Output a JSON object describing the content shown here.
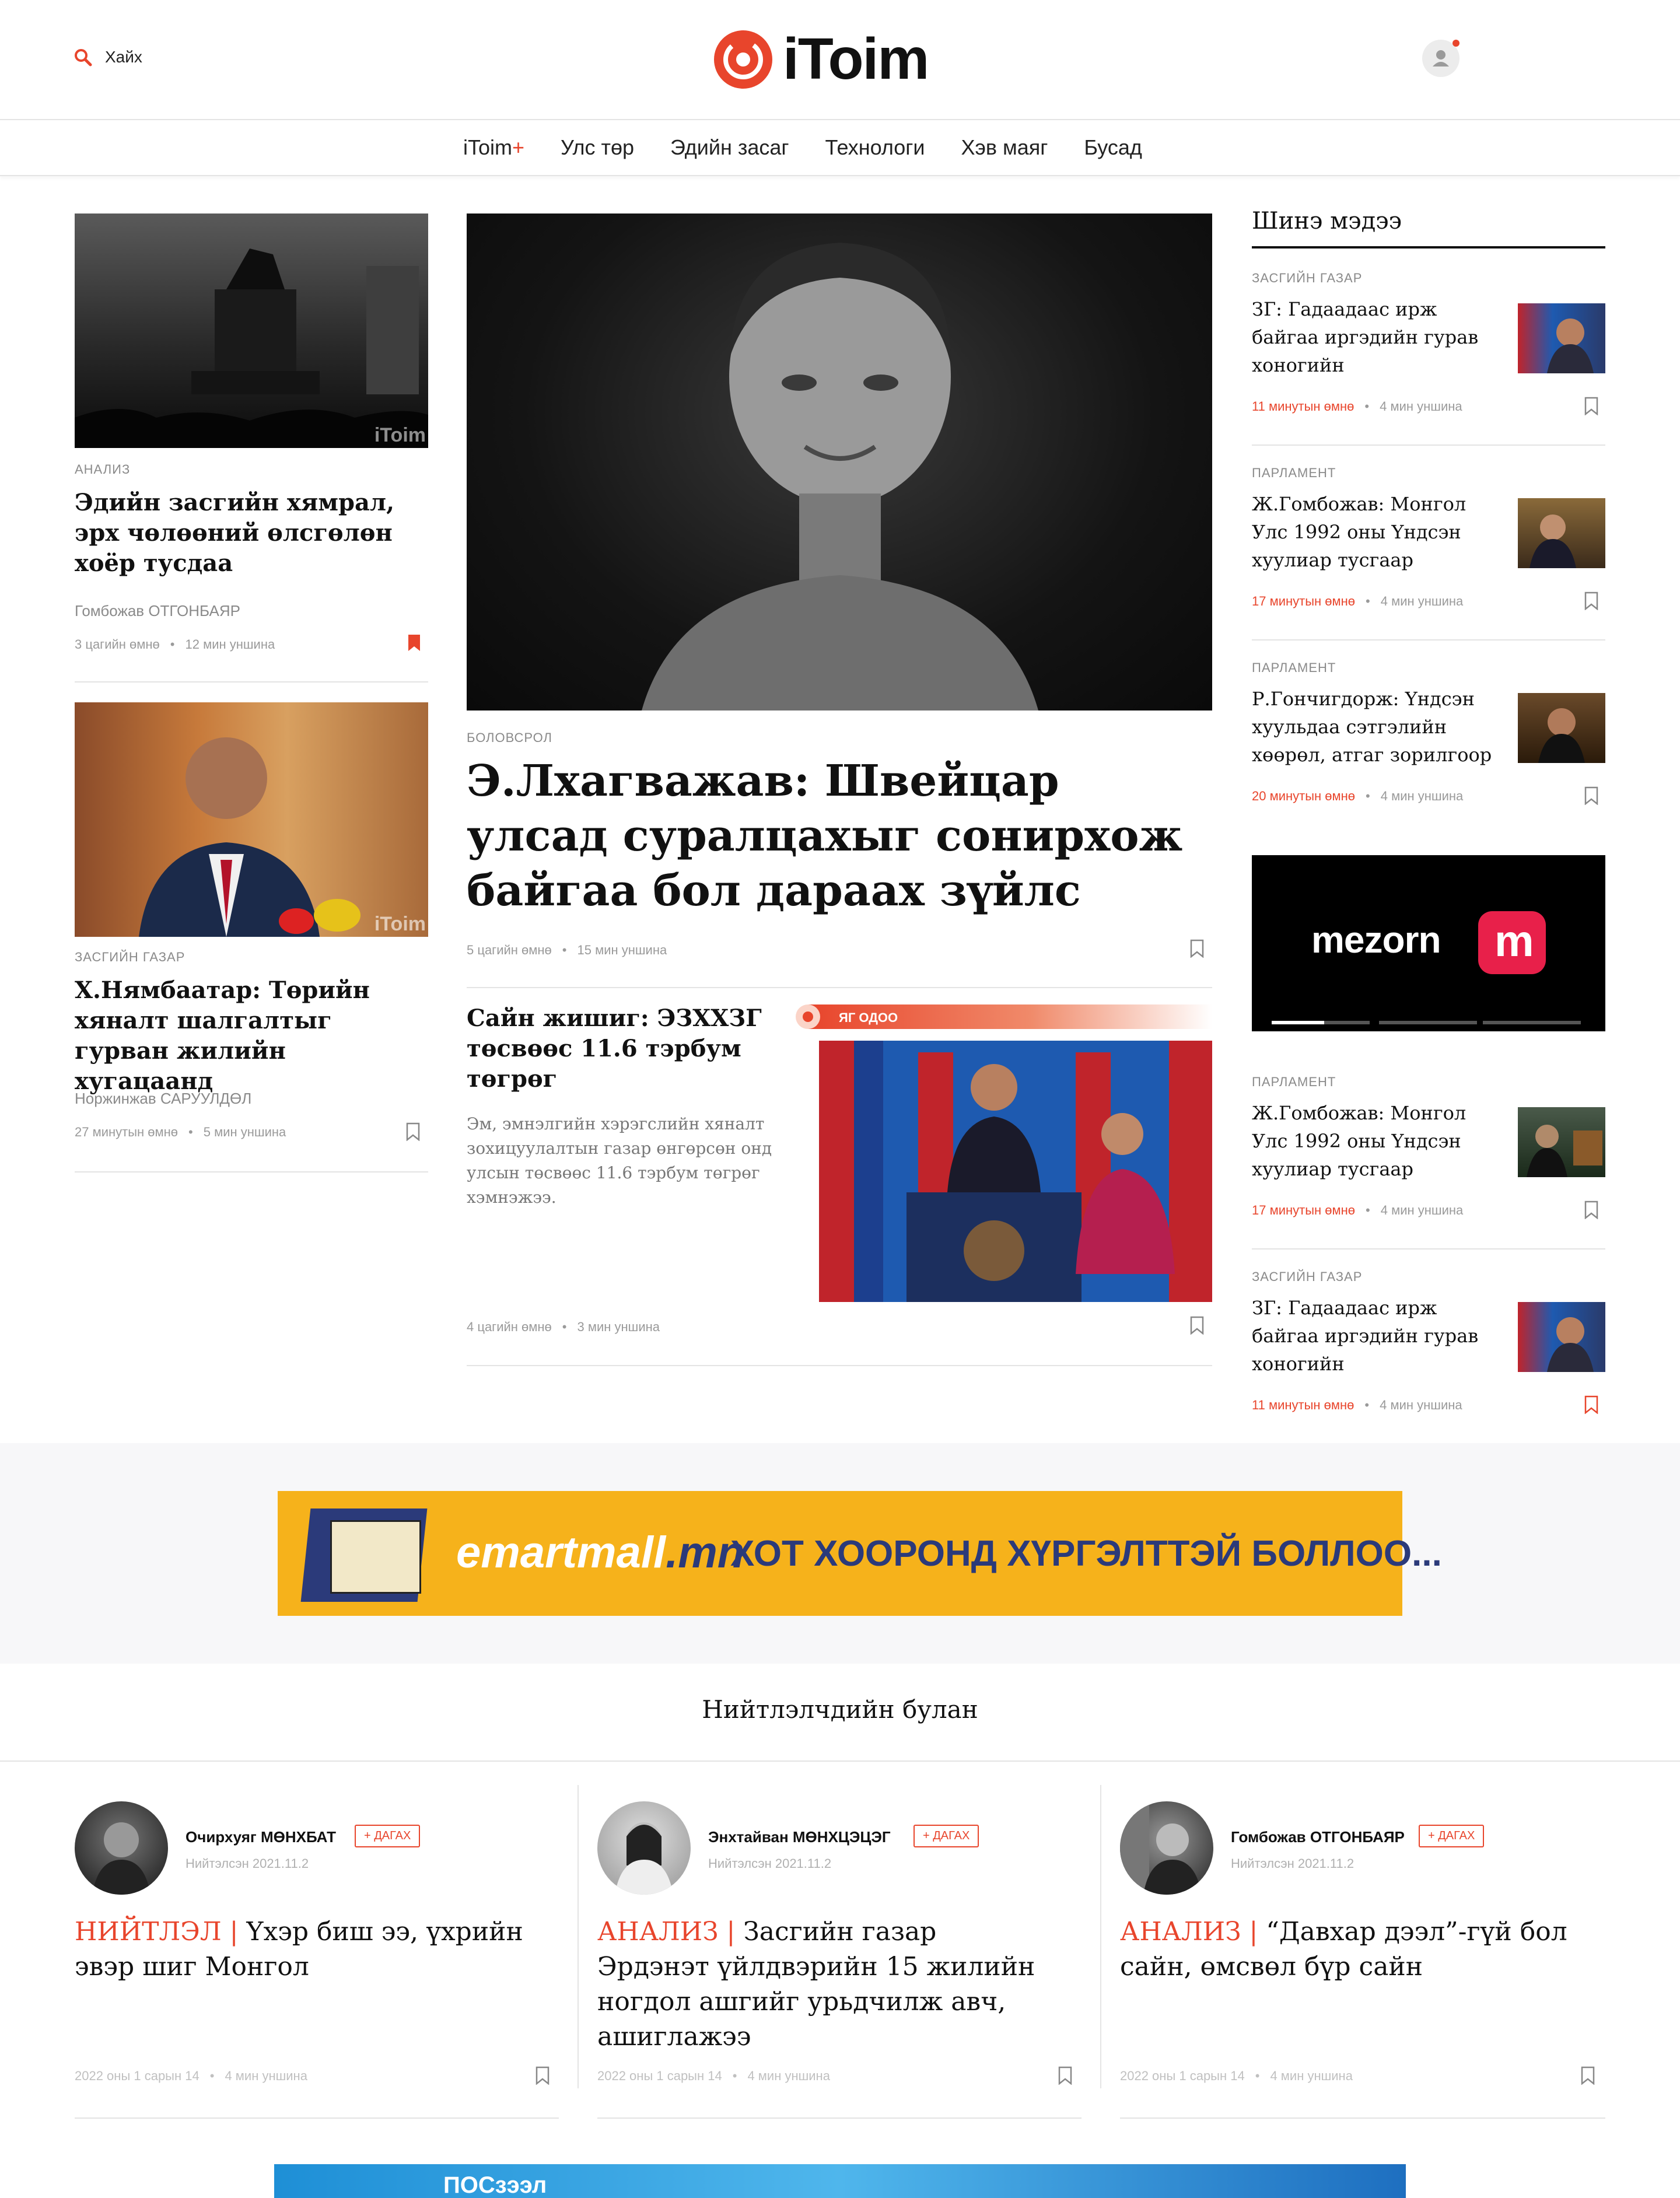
{
  "header": {
    "search_label": "Хайх",
    "logo_text": "iToim",
    "brand_color": "#e8452c"
  },
  "nav": {
    "items": [
      {
        "label": "iToim",
        "plus": "+"
      },
      {
        "label": "Улс төр"
      },
      {
        "label": "Эдийн засаг"
      },
      {
        "label": "Технологи"
      },
      {
        "label": "Хэв маяг"
      },
      {
        "label": "Бусад"
      }
    ]
  },
  "left": {
    "articles": [
      {
        "category": "АНАЛИЗ",
        "title": "Эдийн засгийн хямрал, эрх чөлөөний өлсгөлөн хоёр тусдаа",
        "author": "Гомбожав ОТГОНБАЯР",
        "time": "3 цагийн өмнө",
        "read": "12 мин уншина",
        "image_watermark": "iToim"
      },
      {
        "category": "ЗАСГИЙН ГАЗАР",
        "title": "Х.Нямбаатар: Төрийн хяналт шалгалтыг гурван жилийн хугацаанд",
        "author": "Норжинжав САРУУЛДӨЛ",
        "time": "27 минутын өмнө",
        "read": "5 мин уншина",
        "image_watermark": "iToim"
      }
    ]
  },
  "center": {
    "main": {
      "category": "БОЛОВСРОЛ",
      "title": "Э.Лхагважав: Швейцар улсад суралцахыг сонирхож байгаа бол дараах зүйлс",
      "time": "5 цагийн өмнө",
      "read": "15 мин уншина"
    },
    "secondary": {
      "title": "Сайн жишиг: ЭЗХХЗГ төсвөөс 11.6 тэрбум төгрөг",
      "summary": "Эм, эмнэлгийн хэрэгслийн хяналт зохицуулалтын газар өнгөрсөн онд улсын төсвөөс 11.6 тэрбум төгрөг хэмнэжээ.",
      "live_label": "ЯГ ОДОО",
      "time": "4 цагийн өмнө",
      "read": "3 мин уншина"
    }
  },
  "right": {
    "title": "Шинэ мэдээ",
    "news": [
      {
        "category": "ЗАСГИЙН ГАЗАР",
        "title": "ЗГ: Гадаадаас ирж байгаа иргэдийн гурав хоногийн",
        "time": "11 минутын өмнө",
        "read": "4 мин уншина"
      },
      {
        "category": "ПАРЛАМЕНТ",
        "title": "Ж.Гомбожав: Монгол Улс 1992 оны Үндсэн хуулиар тусгаар",
        "time": "17 минутын өмнө",
        "read": "4 мин уншина"
      },
      {
        "category": "ПАРЛАМЕНТ",
        "title": "Р.Гончигдорж: Үндсэн хуульдаа сэтгэлийн хөөрөл, атгаг зорилгоор",
        "time": "20 минутын өмнө",
        "read": "4 мин уншина"
      },
      {
        "category": "ПАРЛАМЕНТ",
        "title": "Ж.Гомбожав: Монгол Улс 1992 оны Үндсэн хуулиар тусгаар",
        "time": "17 минутын өмнө",
        "read": "4 мин уншина"
      },
      {
        "category": "ЗАСГИЙН ГАЗАР",
        "title": "ЗГ: Гадаадаас ирж байгаа иргэдийн гурав хоногийн",
        "time": "11 минутын өмнө",
        "read": "4 мин уншина"
      }
    ],
    "ad_text": "mezorn",
    "ad_mark": "m"
  },
  "banner": {
    "brand_e": "e",
    "brand_mart": "mart",
    "brand_mall": "mall",
    "brand_mn": ".mn",
    "text": "ХОТ ХООРОНД ХҮРГЭЛТТЭЙ БОЛЛОО...",
    "bg": "#f6b21b"
  },
  "columnists": {
    "title": "Нийтлэлчдийн булан",
    "items": [
      {
        "name": "Очирхуяг МӨНХБАТ",
        "follow": "+ ДАГАХ",
        "published": "Нийтэлсэн 2021.11.2",
        "tag": "НИЙТЛЭЛ",
        "sep": "|",
        "title": "Үхэр биш ээ, үхрийн эвэр шиг Монгол",
        "date": "2022 оны 1 сарын 14",
        "read": "4 мин уншина"
      },
      {
        "name": "Энхтайван МӨНХЦЭЦЭГ",
        "follow": "+ ДАГАХ",
        "published": "Нийтэлсэн 2021.11.2",
        "tag": "АНАЛИЗ",
        "sep": "|",
        "title": "Засгийн газар Эрдэнэт үйлдвэрийн 15 жилийн ногдол ашгийг урьдчилж авч, ашиглажээ",
        "date": "2022 оны 1 сарын 14",
        "read": "4 мин уншина"
      },
      {
        "name": "Гомбожав ОТГОНБАЯР",
        "follow": "+ ДАГАХ",
        "published": "Нийтэлсэн 2021.11.2",
        "tag": "АНАЛИЗ",
        "sep": "|",
        "title": "“Давхар дээл”-гүй бол сайн, өмсвөл бүр сайн",
        "date": "2022 оны 1 сарын 14",
        "read": "4 мин уншина"
      }
    ]
  },
  "bottom_banner": {
    "text": "ПОСзээл"
  }
}
